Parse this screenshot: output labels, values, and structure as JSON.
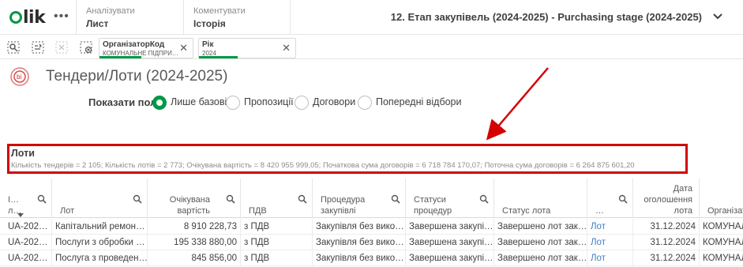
{
  "topbar": {
    "logo": "Qlik",
    "more_icon": "ellipsis-icon",
    "tabs": [
      {
        "sub": "Аналізувати",
        "main": "Лист"
      },
      {
        "sub": "Коментувати",
        "main": "Історія"
      }
    ],
    "app_title": "12. Етап закупівель (2024-2025) - Purchasing stage (2024-2025)"
  },
  "selections": {
    "icons": [
      "smart-search-icon",
      "selections-tool-icon",
      "step-forward-icon",
      "clear-all-icon"
    ],
    "chips": [
      {
        "title": "ОрганізаторКод",
        "value": "КОМУНАЛЬНЕ ПІДПРИ…",
        "fill": 0.45
      },
      {
        "title": "Рік",
        "value": "2024",
        "fill": 0.4
      }
    ]
  },
  "sheet": {
    "title": "Тендери/Лоти (2024-2025)"
  },
  "show_fields": {
    "label": "Показати поля:",
    "options": [
      {
        "label": "Лише базові",
        "selected": true
      },
      {
        "label": "Пропозиції",
        "selected": false
      },
      {
        "label": "Договори",
        "selected": false
      },
      {
        "label": "Попередні відбори",
        "selected": false
      }
    ]
  },
  "lots": {
    "title": "Лоти",
    "stats": "Кількість тендерів = 2 105; Кількість лотів = 2 773; Очікувана вартість = 8 420 955 999,05; Початкова сума договорів = 6 718 784 170,07; Поточна сума договорів = 6 264 875 601,20"
  },
  "table": {
    "headers": [
      "І… л…",
      "Лот",
      "Очікувана вартість",
      "ПДВ",
      "Процедура закупівлі",
      "Статуси процедур",
      "Статус лота",
      "…",
      "Дата оголошення лота",
      "Організато"
    ],
    "rows": [
      [
        "UA-202…",
        "Капітальний ремон…",
        "8 910 228,73",
        "з ПДВ",
        "Закупівля без вико…",
        "Завершена закупі…",
        "Завершено лот зак…",
        "Лот",
        "31.12.2024",
        "КОМУНАЛ"
      ],
      [
        "UA-202…",
        "Послуги з обробки …",
        "195 338 880,00",
        "з ПДВ",
        "Закупівля без вико…",
        "Завершена закупі…",
        "Завершено лот зак…",
        "Лот",
        "31.12.2024",
        "КОМУНАЛ"
      ],
      [
        "UA-202…",
        "Послуга з проведен…",
        "845 856,00",
        "з ПДВ",
        "Закупівля без вико…",
        "Завершена закупі…",
        "Завершено лот зак…",
        "Лот",
        "31.12.2024",
        "КОМУНАЛ"
      ]
    ]
  },
  "colors": {
    "accent": "#009845",
    "highlight": "#d50000",
    "link": "#3d7fc4"
  }
}
